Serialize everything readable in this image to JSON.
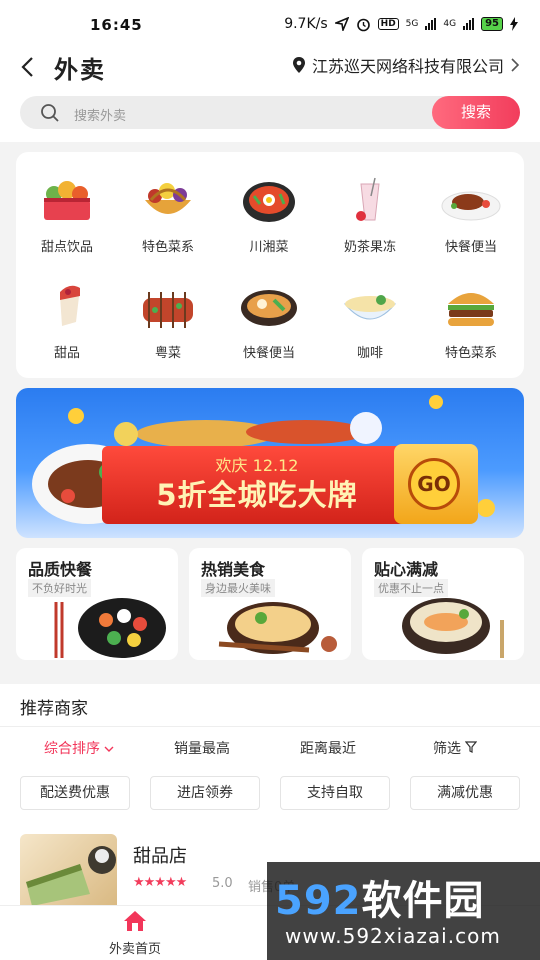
{
  "status_bar": {
    "time": "16:45",
    "speed": "9.7K/s",
    "hd": "HD",
    "net1": "5G",
    "net2": "4G",
    "battery": "95"
  },
  "header": {
    "back_icon": "chevron-left-icon",
    "title": "外卖",
    "location": "江苏巡天网络科技有限公司"
  },
  "search": {
    "placeholder": "搜索外卖",
    "button": "搜索"
  },
  "categories": [
    {
      "label": "甜点饮品",
      "icon": "dessert-basket-icon"
    },
    {
      "label": "特色菜系",
      "icon": "fruit-basket-icon"
    },
    {
      "label": "川湘菜",
      "icon": "stone-pot-icon"
    },
    {
      "label": "奶茶果冻",
      "icon": "milk-tea-icon"
    },
    {
      "label": "快餐便当",
      "icon": "steak-plate-icon"
    },
    {
      "label": "甜品",
      "icon": "cake-icon"
    },
    {
      "label": "粤菜",
      "icon": "skewers-icon"
    },
    {
      "label": "快餐便当",
      "icon": "bento-bowl-icon"
    },
    {
      "label": "咖啡",
      "icon": "noodle-bowl-icon"
    },
    {
      "label": "特色菜系",
      "icon": "burger-icon"
    }
  ],
  "banner": {
    "subtitle": "欢庆 12.12",
    "headline": "5折全城吃大牌",
    "go": "GO"
  },
  "promos": [
    {
      "title": "品质快餐",
      "sub": "不负好时光"
    },
    {
      "title": "热销美食",
      "sub": "身边最火美味"
    },
    {
      "title": "贴心满减",
      "sub": "优惠不止一点"
    }
  ],
  "recommend": {
    "title": "推荐商家",
    "sorts": [
      "综合排序",
      "销量最高",
      "距离最近",
      "筛选"
    ],
    "chips": [
      "配送费优惠",
      "进店领券",
      "支持自取",
      "满减优惠"
    ],
    "shop": {
      "name": "甜品店",
      "stars": "★★★★★",
      "score": "5.0",
      "sales": "销售0单"
    }
  },
  "tabbar": {
    "home": "外卖首页"
  },
  "watermark": {
    "brand_num": "592",
    "brand_text": "软件园",
    "url": "www.592xiazai.com"
  },
  "colors": {
    "accent": "#f2365a",
    "banner_blue": "#2b7cf0"
  }
}
